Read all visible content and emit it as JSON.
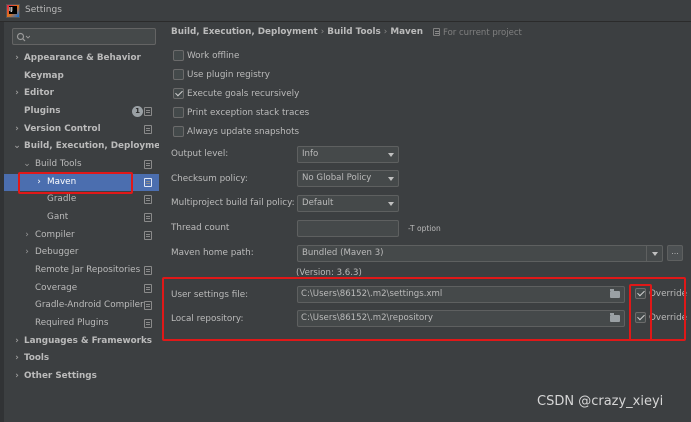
{
  "window": {
    "title": "Settings"
  },
  "search": {
    "placeholder": ""
  },
  "sidebar": {
    "items": [
      {
        "label": "Appearance & Behavior",
        "expand": "collapsed"
      },
      {
        "label": "Keymap"
      },
      {
        "label": "Editor",
        "expand": "collapsed"
      },
      {
        "label": "Plugins",
        "badge": "1"
      },
      {
        "label": "Version Control",
        "expand": "collapsed"
      },
      {
        "label": "Build, Execution, Deployment",
        "expand": "expanded"
      },
      {
        "label": "Build Tools",
        "expand": "expanded"
      },
      {
        "label": "Maven",
        "expand": "collapsed",
        "selected": true
      },
      {
        "label": "Gradle"
      },
      {
        "label": "Gant"
      },
      {
        "label": "Compiler",
        "expand": "collapsed"
      },
      {
        "label": "Debugger",
        "expand": "collapsed"
      },
      {
        "label": "Remote Jar Repositories"
      },
      {
        "label": "Coverage"
      },
      {
        "label": "Gradle-Android Compiler"
      },
      {
        "label": "Required Plugins"
      },
      {
        "label": "Languages & Frameworks",
        "expand": "collapsed"
      },
      {
        "label": "Tools",
        "expand": "collapsed"
      },
      {
        "label": "Other Settings",
        "expand": "collapsed"
      }
    ]
  },
  "breadcrumb": {
    "parts": [
      "Build, Execution, Deployment",
      "Build Tools",
      "Maven"
    ],
    "separator": "›",
    "scope": "For current project"
  },
  "maven": {
    "checkboxes": [
      {
        "label": "Work offline",
        "checked": false
      },
      {
        "label": "Use plugin registry",
        "checked": false
      },
      {
        "label": "Execute goals recursively",
        "checked": true
      },
      {
        "label": "Print exception stack traces",
        "checked": false
      },
      {
        "label": "Always update snapshots",
        "checked": false
      }
    ],
    "output_level": {
      "label": "Output level:",
      "value": "Info"
    },
    "checksum_policy": {
      "label": "Checksum policy:",
      "value": "No Global Policy"
    },
    "fail_policy": {
      "label": "Multiproject build fail policy:",
      "value": "Default"
    },
    "thread_count": {
      "label": "Thread count",
      "value": "",
      "hint": "-T option"
    },
    "home_path": {
      "label": "Maven home path:",
      "value": "Bundled (Maven 3)",
      "browse": "...",
      "version": "(Version: 3.6.3)"
    },
    "user_settings": {
      "label": "User settings file:",
      "value": "C:\\Users\\86152\\.m2\\settings.xml",
      "override_label": "Override",
      "override": true
    },
    "local_repo": {
      "label": "Local repository:",
      "value": "C:\\Users\\86152\\.m2\\repository",
      "override_label": "Override",
      "override": true
    }
  },
  "colors": {
    "accent_selection": "#4b6eaf",
    "annotation_red": "#e01818",
    "panel": "#3c3f41"
  },
  "watermark": "CSDN @crazy_xieyi"
}
